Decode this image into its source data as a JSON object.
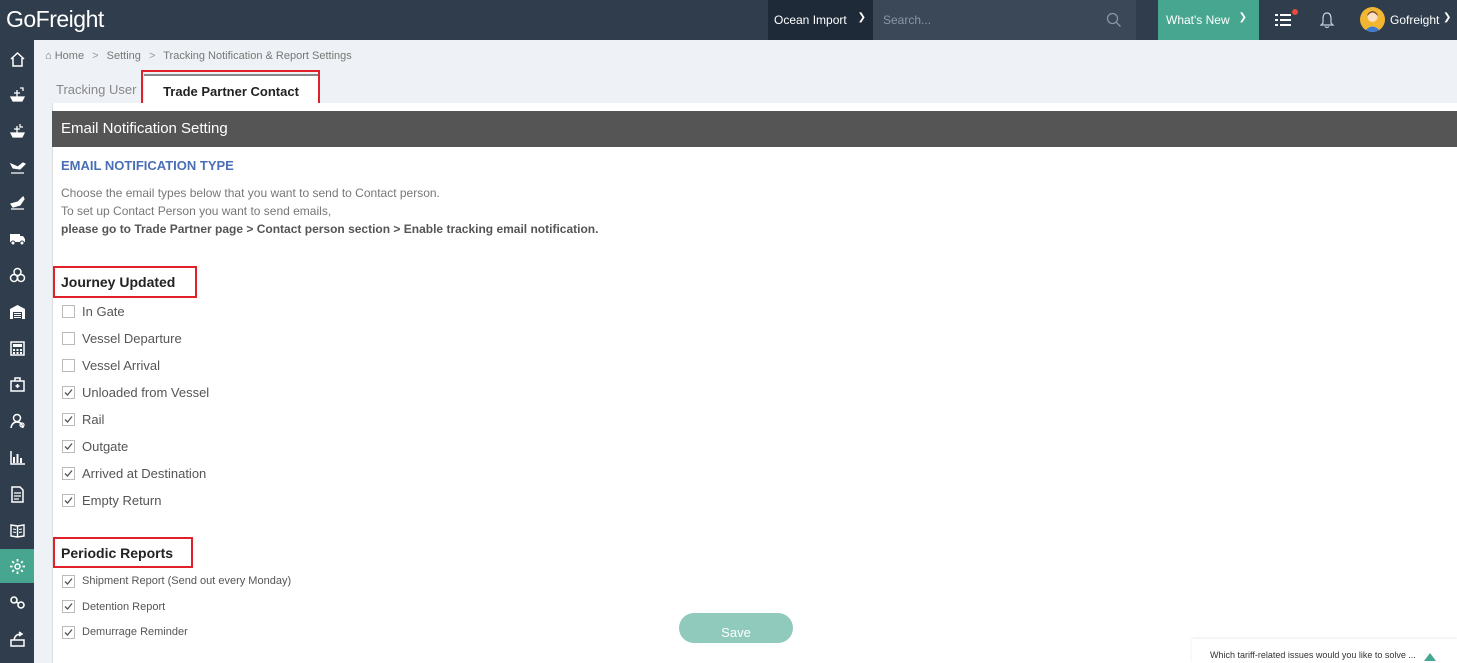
{
  "header": {
    "logo": "GoFreight",
    "mode": "Ocean Import",
    "search_placeholder": "Search...",
    "whats_new": "What's New",
    "user": "Gofreight"
  },
  "breadcrumb": [
    "Home",
    "Setting",
    "Tracking Notification & Report Settings"
  ],
  "tabs": [
    {
      "label": "Tracking User",
      "active": false
    },
    {
      "label": "Trade Partner Contact",
      "active": true
    }
  ],
  "panel": {
    "title": "Email Notification Setting",
    "section_title": "EMAIL NOTIFICATION TYPE",
    "desc_line1": "Choose the email types below that you want to send to Contact person.",
    "desc_line2": "To set up Contact Person you want to send emails,",
    "desc_line3": "please go to Trade Partner page > Contact person section > Enable tracking email notification."
  },
  "journey": {
    "title": "Journey Updated",
    "items": [
      {
        "label": "In Gate",
        "checked": false
      },
      {
        "label": "Vessel Departure",
        "checked": false
      },
      {
        "label": "Vessel Arrival",
        "checked": false
      },
      {
        "label": "Unloaded from Vessel",
        "checked": true
      },
      {
        "label": "Rail",
        "checked": true
      },
      {
        "label": "Outgate",
        "checked": true
      },
      {
        "label": "Arrived at Destination",
        "checked": true
      },
      {
        "label": "Empty Return",
        "checked": true
      }
    ]
  },
  "periodic": {
    "title": "Periodic Reports",
    "items": [
      {
        "label": "Shipment Report (Send out every Monday)",
        "checked": true
      },
      {
        "label": "Detention Report",
        "checked": true
      },
      {
        "label": "Demurrage Reminder",
        "checked": true
      }
    ]
  },
  "save_label": "Save",
  "survey_text": "Which tariff-related issues would you like to solve ...",
  "sidenav_icons": [
    "home-icon",
    "ocean-export-icon",
    "ocean-import-icon",
    "air-export-icon",
    "air-import-icon",
    "truck-icon",
    "misc-icon",
    "warehouse-icon",
    "accounting-icon",
    "toolbox-icon",
    "contacts-icon",
    "reports-icon",
    "document-icon",
    "book-icon",
    "settings-icon",
    "link-icon",
    "share-icon"
  ],
  "colors": {
    "accent": "#47a690",
    "topbar": "#2f3d4c",
    "highlight": "#e0202b",
    "section_title": "#4a6fb5"
  }
}
